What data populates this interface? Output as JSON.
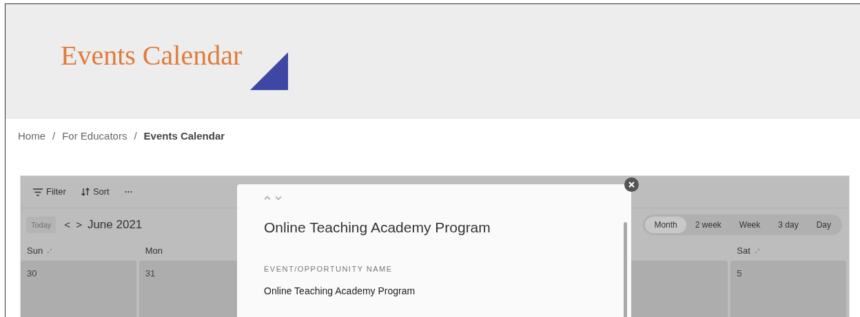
{
  "header": {
    "title": "Events Calendar"
  },
  "breadcrumb_separator": "/",
  "breadcrumb": [
    {
      "label": "Home",
      "current": false
    },
    {
      "label": "For Educators",
      "current": false
    },
    {
      "label": "Events Calendar",
      "current": true
    }
  ],
  "toolbar": {
    "filter": "Filter",
    "sort": "Sort",
    "more": "···"
  },
  "calendar": {
    "today": {
      "label": "Today",
      "disabled": true
    },
    "prev": "<",
    "next": ">",
    "month": "June 2021",
    "views": [
      {
        "label": "Month",
        "selected": true
      },
      {
        "label": "2 week",
        "selected": false
      },
      {
        "label": "Week",
        "selected": false
      },
      {
        "label": "3 day",
        "selected": false
      },
      {
        "label": "Day",
        "selected": false
      }
    ],
    "columns_left": [
      {
        "day": "Sun",
        "expand": true,
        "date": "30"
      },
      {
        "day": "Mon",
        "expand": false,
        "date": "31"
      }
    ],
    "columns_right": [
      {
        "day": "Sat",
        "expand": true,
        "date": "5"
      }
    ]
  },
  "modal": {
    "title": "Online Teaching Academy Program",
    "field_label": "EVENT/OPPORTUNITY NAME",
    "field_value": "Online Teaching Academy Program"
  }
}
